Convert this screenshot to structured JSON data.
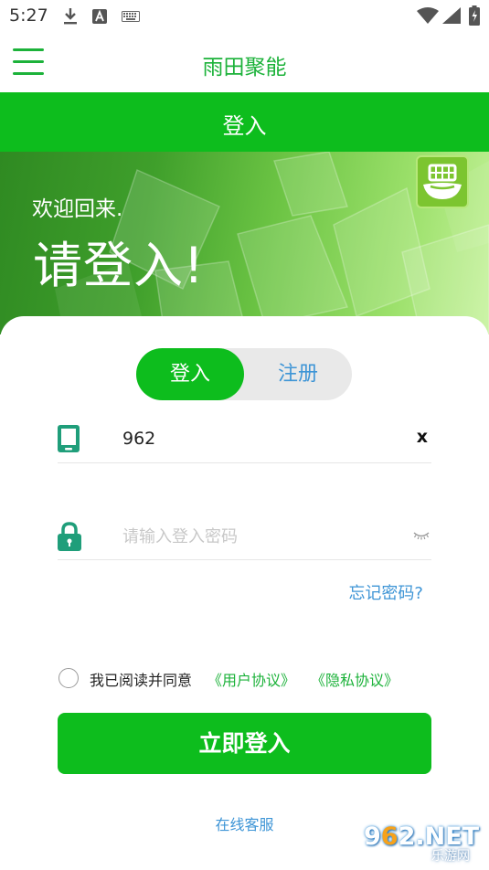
{
  "status_bar": {
    "time": "5:27",
    "icons": [
      "download-icon",
      "a-notification-icon",
      "keyboard-icon",
      "wifi-icon",
      "signal-icon",
      "battery-icon"
    ]
  },
  "header": {
    "menu_icon": "hamburger-menu-icon",
    "app_title": "雨田聚能"
  },
  "green_bar": {
    "title": "登入"
  },
  "banner": {
    "welcome": "欢迎回来.",
    "prompt": "请登入!",
    "logo_icon": "app-logo-icon"
  },
  "tabs": {
    "login": "登入",
    "register": "注册",
    "active": "login"
  },
  "phone_field": {
    "icon": "phone-icon",
    "value": "962",
    "clear_label": "x"
  },
  "password_field": {
    "icon": "lock-icon",
    "placeholder": "请输入登入密码",
    "toggle_icon": "eye-closed-icon"
  },
  "forgot_password": "忘记密码?",
  "agreement": {
    "text": "我已阅读并同意",
    "user_agreement": "《用户协议》",
    "privacy_policy": "《隐私协议》",
    "checked": false
  },
  "submit_label": "立即登入",
  "online_service": "在线客服",
  "watermark": {
    "number_prefix": "9",
    "number_highlight": "6",
    "number_suffix": "2.NET",
    "subtitle": "乐游网"
  },
  "colors": {
    "primary_green": "#0dbd1d",
    "title_green": "#1cb23a",
    "link_blue": "#3e95d6"
  }
}
